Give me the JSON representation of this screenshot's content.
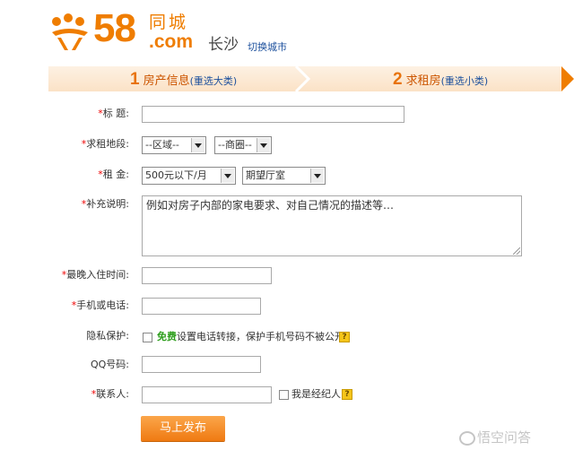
{
  "header": {
    "logo_number": "58",
    "logo_name": "同城",
    "logo_domain": ".com",
    "city": "长沙",
    "switch_city": "切换城市"
  },
  "steps": [
    {
      "number": "1",
      "label": "房产信息",
      "link": "(重选大类)"
    },
    {
      "number": "2",
      "label": "求租房",
      "link": "(重选小类)"
    }
  ],
  "form": {
    "title_label": "标 题:",
    "location_label": "求租地段:",
    "district_select": "--区域--",
    "area_select": "--商圈--",
    "rent_label": "租 金:",
    "rent_select": "500元以下/月",
    "room_select": "期望厅室",
    "extra_label": "补充说明:",
    "extra_text": "例如对房子内部的家电要求、对自己情况的描述等…",
    "movein_label": "最晚入住时间:",
    "phone_label": "手机或电话:",
    "privacy_label": "隐私保护:",
    "privacy_free": "免费",
    "privacy_text": "设置电话转接，保护手机号码不被公开",
    "qq_label": "QQ号码:",
    "contact_label": "联系人:",
    "agent_text": "我是经纪人",
    "required_mark": "*",
    "help_mark": "?"
  },
  "publish_button": "马上发布",
  "watermark": "悟空问答",
  "colors": {
    "brand_orange": "#ef7d00",
    "link_blue": "#1b4f9c",
    "required_red": "#ee0000",
    "free_green": "#2e9e1d"
  }
}
